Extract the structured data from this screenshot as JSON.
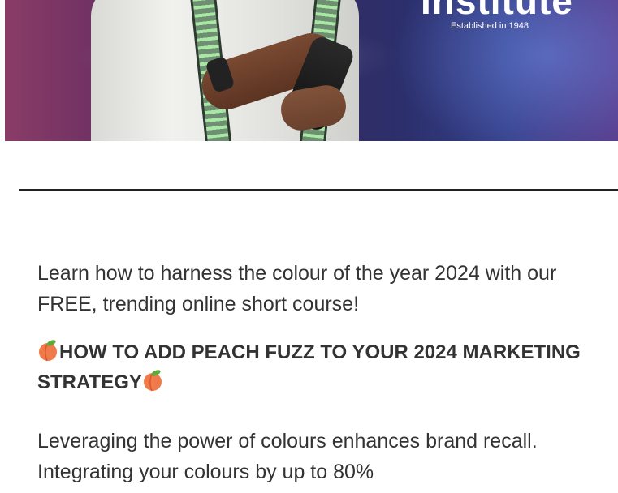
{
  "hero": {
    "brand_word": "Institute",
    "brand_tagline": "Established in 1948"
  },
  "article": {
    "intro": "Learn how to harness the colour of the year 2024 with our FREE, trending online short course!",
    "headline": "HOW TO ADD PEACH FUZZ TO YOUR 2024 MARKETING STRATEGY",
    "paragraph": "Leveraging the power of colours enhances brand recall. Integrating your colours by up to 80%"
  },
  "icons": {
    "peach": "peach-icon"
  },
  "colors": {
    "text": "#333333",
    "peach": "#f07a4a",
    "leaf": "#5fa83a"
  }
}
